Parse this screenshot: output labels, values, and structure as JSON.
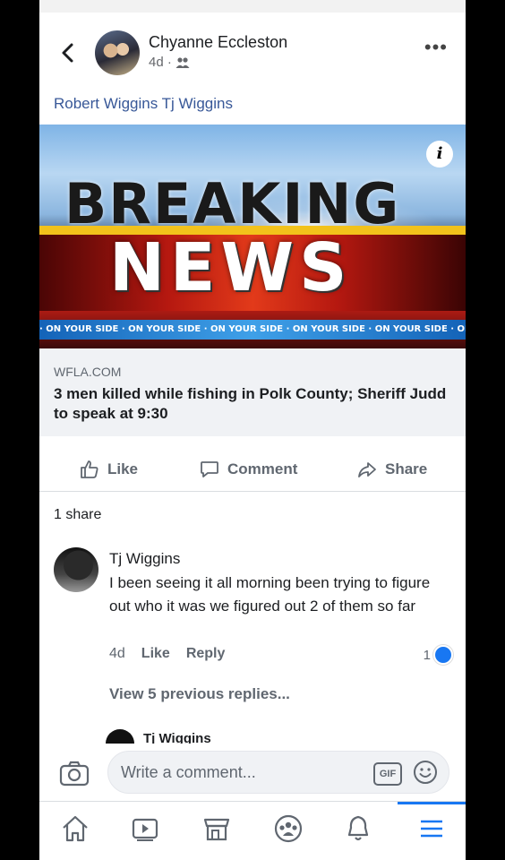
{
  "post": {
    "author": "Chyanne Eccleston",
    "time": "4d ·",
    "tagged_line": "Robert Wiggins Tj Wiggins"
  },
  "image": {
    "headline_top": "BREAKING",
    "headline_bottom": "NEWS",
    "ticker": "· ON YOUR SIDE · ON YOUR SIDE · ON YOUR SIDE · ON YOUR SIDE · ON YOUR SIDE · ON YOUR SIDE"
  },
  "link": {
    "domain": "WFLA.COM",
    "title": "3 men killed while fishing in Polk County; Sheriff Judd to speak at 9:30"
  },
  "actions": {
    "like": "Like",
    "comment": "Comment",
    "share": "Share"
  },
  "share_count": "1 share",
  "comment": {
    "author": "Tj Wiggins",
    "text": "I been seeing it all morning been trying to figure out who it was we figured out 2 of them so far",
    "time": "4d",
    "like": "Like",
    "reply": "Reply",
    "reactions": "1"
  },
  "view_more": "View 5 previous replies...",
  "next_reply_author": "Tj Wiggins",
  "composer": {
    "placeholder": "Write a comment...",
    "gif": "GIF"
  },
  "colors": {
    "link_blue": "#385898",
    "facebook_blue": "#1877f2",
    "gray_text": "#606770"
  },
  "icons": [
    "back-arrow-icon",
    "friends-icon",
    "more-icon",
    "info-icon",
    "like-icon",
    "comment-icon",
    "share-icon",
    "camera-icon",
    "emoji-icon",
    "home-icon",
    "watch-icon",
    "marketplace-icon",
    "groups-icon",
    "notifications-icon",
    "menu-icon"
  ]
}
